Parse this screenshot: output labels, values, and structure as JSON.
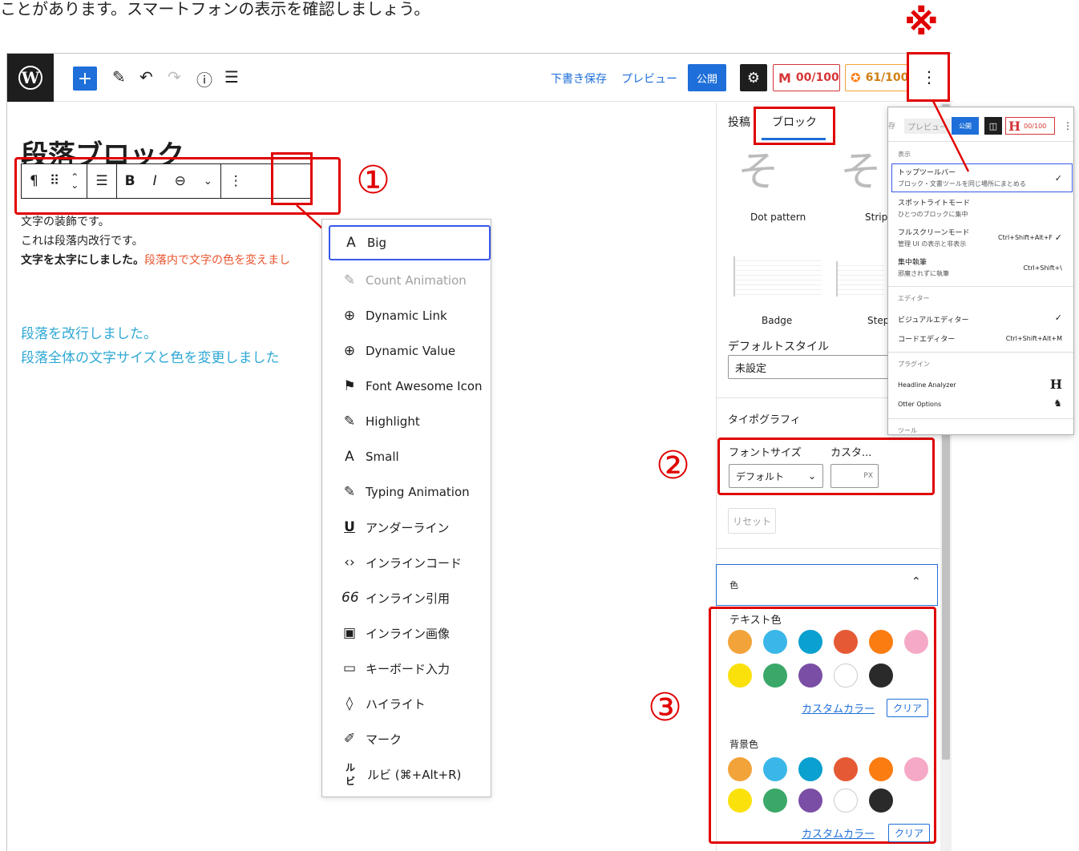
{
  "caption": "ことがあります。スマートフォンの表示を確認しましょう。",
  "annotations": {
    "kome": "※",
    "n1": "①",
    "n2": "②",
    "n3": "③"
  },
  "topbar": {
    "save_draft": "下書き保存",
    "preview": "プレビュー",
    "publish": "公開",
    "score1": "00/100",
    "score2": "61/100"
  },
  "block_toolbar": {
    "paragraph": "¶",
    "drag": "⠿",
    "bold": "B",
    "italic": "I"
  },
  "editor": {
    "heading_partial": "段落ブロック",
    "line1": "文字の装飾です。",
    "line2": "これは段落内改行です。",
    "line3_bold": "文字を太字にしました。",
    "line3_red": "段落内で文字の色を変えまし",
    "blue1": "段落を改行しました。",
    "blue2": "段落全体の文字サイズと色を変更しました"
  },
  "format_menu": {
    "items": [
      {
        "icon": "A",
        "label": "Big"
      },
      {
        "icon": "✎",
        "label": "Count Animation"
      },
      {
        "icon": "⊕",
        "label": "Dynamic Link"
      },
      {
        "icon": "⊕",
        "label": "Dynamic Value"
      },
      {
        "icon": "⚑",
        "label": "Font Awesome Icon"
      },
      {
        "icon": "✎",
        "label": "Highlight"
      },
      {
        "icon": "A",
        "label": "Small"
      },
      {
        "icon": "✎",
        "label": "Typing Animation"
      },
      {
        "icon": "U",
        "label": "アンダーライン"
      },
      {
        "icon": "‹›",
        "label": "インラインコード"
      },
      {
        "icon": "66",
        "label": "インライン引用"
      },
      {
        "icon": "▣",
        "label": "インライン画像"
      },
      {
        "icon": "▭",
        "label": "キーボード入力"
      },
      {
        "icon": "◊",
        "label": "ハイライト"
      },
      {
        "icon": "✐",
        "label": "マーク"
      },
      {
        "icon": "ルビ",
        "label": "ルビ (⌘+Alt+R)"
      }
    ]
  },
  "sidebar": {
    "tab_post": "投稿",
    "tab_block": "ブロック",
    "style1": "Dot pattern",
    "style2": "Strip",
    "style3": "Badge",
    "style4": "Step",
    "thumb_char": "そ",
    "default_style_label": "デフォルトスタイル",
    "default_style_value": "未設定",
    "typography": "タイポグラフィ",
    "font_size_label": "フォントサイズ",
    "custom_label": "カスタ...",
    "font_size_value": "デフォルト",
    "px": "PX",
    "reset": "リセット",
    "color_section": "色",
    "text_color": "テキスト色",
    "bg_color": "背景色",
    "custom_color": "カスタムカラー",
    "clear": "クリア",
    "palette": [
      "#f2a33a",
      "#3ab7e8",
      "#0aa0cf",
      "#e55a35",
      "#fb7c10",
      "#f5a9c6",
      "#fbe10c",
      "#3aa868",
      "#7a4ea5",
      "#ffffff",
      "#2a2a2a"
    ]
  },
  "options_menu": {
    "save": "存",
    "preview": "プレビュー",
    "publish": "公開",
    "score": "00/100",
    "view_head": "表示",
    "top_toolbar": "トップツールバー",
    "top_toolbar_sub": "ブロック・文書ツールを同じ場所にまとめる",
    "spotlight": "スポットライトモード",
    "spotlight_sub": "ひとつのブロックに集中",
    "fullscreen": "フルスクリーンモード",
    "fullscreen_sub": "管理 UI の表示と非表示",
    "fullscreen_sc": "Ctrl+Shift+Alt+F",
    "distraction": "集中執筆",
    "distraction_sub": "邪魔されずに執筆",
    "distraction_sc": "Ctrl+Shift+\\",
    "editor_head": "エディター",
    "visual": "ビジュアルエディター",
    "code": "コードエディター",
    "code_sc": "Ctrl+Shift+Alt+M",
    "plugins_head": "プラグイン",
    "headline": "Headline Analyzer",
    "otter": "Otter Options",
    "tools_head": "ツール",
    "check": "✓"
  }
}
